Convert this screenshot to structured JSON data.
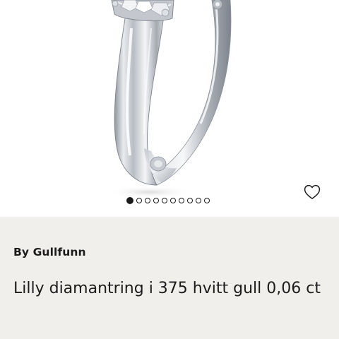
{
  "product": {
    "brand": "By Gullfunn",
    "title": "Lilly diamantring i 375 hvitt gull 0,06 ct",
    "image_icon": "ring-photo"
  },
  "gallery": {
    "dot_count": 10,
    "active_index": 0,
    "favorite_icon": "heart-outline-icon"
  },
  "colors": {
    "info_background": "#f0efec",
    "text": "#1c1c1c",
    "metal": "#c9ccd2"
  }
}
